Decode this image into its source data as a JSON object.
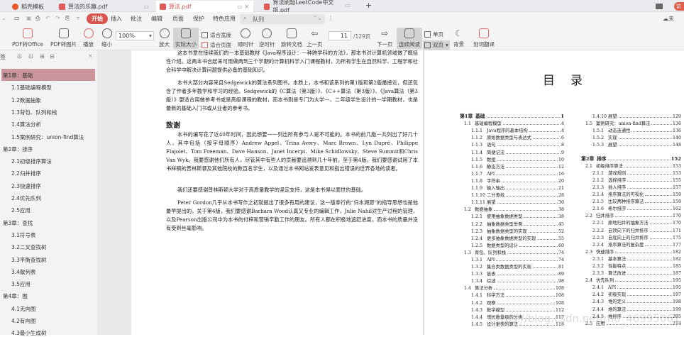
{
  "tabs": [
    {
      "label": "稻壳模板",
      "active": false
    },
    {
      "label": "算法的乐趣.pdf",
      "active": false
    },
    {
      "label": "算法.pdf",
      "active": true
    },
    {
      "label": "算法刷题LeetCode中文版.pdf",
      "active": false
    }
  ],
  "new_tab": "+",
  "account_button": "访",
  "menu": {
    "items": [
      "开始",
      "插入",
      "批注",
      "编辑",
      "页面",
      "保护",
      "特色应用"
    ],
    "search_value": "队列",
    "cloud": "未"
  },
  "toolbar": {
    "pdf_to_office": "PDF转Office",
    "pdf_to_image": "PDF转图片",
    "play": "播放",
    "zoom_out": "缩小",
    "zoom_value": "100%",
    "zoom_in": "放大",
    "actual_size": "实际大小",
    "fit_width": "适合宽度",
    "fit_page": "适合页面",
    "rotate_cw": "顺时针",
    "rotate_ccw": "逆时针",
    "rotate_doc": "旋转文档",
    "prev_page": "上一页",
    "page_current": "11",
    "page_total": "/129页",
    "next_page": "下一页",
    "continuous": "连续阅读",
    "single": "单页",
    "double": "双页",
    "background": "背景",
    "translate": "划词翻译"
  },
  "sidebar": {
    "title": "签",
    "close": "×",
    "items": [
      {
        "label": "第1章：基础",
        "level": 0
      },
      {
        "label": "1.1基础编程模型",
        "level": 1
      },
      {
        "label": "1.2数据抽象",
        "level": 1
      },
      {
        "label": "1.3背包、队列和栈",
        "level": 1
      },
      {
        "label": "1.4算法分析",
        "level": 1
      },
      {
        "label": "1.5案例研究：union-find算法",
        "level": 1
      },
      {
        "label": "第2章：排序",
        "level": 0
      },
      {
        "label": "2.1初级排序算法",
        "level": 1
      },
      {
        "label": "2.2归并排序",
        "level": 1
      },
      {
        "label": "2.3快速排序",
        "level": 1
      },
      {
        "label": "2.4优先队列",
        "level": 1
      },
      {
        "label": "2.5应用",
        "level": 1
      },
      {
        "label": "第3章：查找",
        "level": 0
      },
      {
        "label": "3.1符号表",
        "level": 1
      },
      {
        "label": "3.2二叉查找树",
        "level": 1
      },
      {
        "label": "3.3平衡查找树",
        "level": 1
      },
      {
        "label": "3.4散列表",
        "level": 1
      },
      {
        "label": "3.5应用",
        "level": 1
      },
      {
        "label": "第4章：图",
        "level": 0
      },
      {
        "label": "4.1无向图",
        "level": 1
      },
      {
        "label": "4.2有向图",
        "level": 1
      },
      {
        "label": "4.3最小生成树",
        "level": 1
      }
    ]
  },
  "left_page": {
    "para1": "这本书意在接续我们的一本基础教材《Java程序设计：一种跨学科的方法》，那本书对计算机领域做了概括性介绍。这两本书合起来可用做两到三个学期的计算机科学入门课程教材，为所有学生在自然科学、工程学和社会科学中解决计算问题提供必备的基础知识。",
    "para2": "本书大部分内容来自Sedgewick的算法系列图书。本质上，本书和该系列的第1版和第2版最接近，但还包含了作者多年教学和学习的经验。Sedgewick的《C算法（第3版）》、《C++算法（第3版）》、《Java算法（第3版）》更适合用做参考书或是高级课程的教材，而本书则是专门为大学一、二年级学生设计的一学期教材，也是最新的基础入门书或从业者的参考书。",
    "heading": "致谢",
    "para3": "本书的编写花了近40年时间，因此想要一一列出所有参与人是不可能的。本书的前几版一共列出了好几十人，其中包括（按字母顺序）Andrew Appel、Trina Avery、Marc Brown、Lyn Dupré、Philippe Flajolet、Tom Freeman、Dave Hanson、Janet Incerpi、Mike Schidlowsky、Steve Summit和Chris Van Wyk。我要感谢他们所有人，尽管其中有些人的贡献要追溯到几十年前。至于第4版，我们要感谢试用了本书样稿的普林斯顿及其他院校的数百名学生，以及通过本书网站发表意见和指出错误的世界各地的读者。",
    "para4": "我们还要感谢普林斯顿大学对于高质量教学的坚定支持，这是本书得以面世的基础。",
    "para5": "Peter Gordon几乎从本书写作之初就提出了很多有用的建议，这一版奉行的“归本溯源”的指导思想也是他最早提出的。关于第4版，我们要感谢Barbara Wood认真又专业的编辑工作，Julie Nahil对生产过程的管理，以及Pearson出版公司中为本书的付梓和营销辛勤工作的朋友。所有人都在积极地追赶进度，而本书的质量并没有受到丝毫影响。"
  },
  "right_page": {
    "title": "目录",
    "watermark": "https://blog.csdn.net/m0_46995061",
    "toc_left": [
      {
        "num": "第1章",
        "title": "基础",
        "page": "1",
        "level": 0
      },
      {
        "num": "1.1",
        "title": "基础编程模型",
        "page": "4",
        "level": 1
      },
      {
        "num": "1.1.1",
        "title": "Java程序的基本结构",
        "page": "4",
        "level": 2
      },
      {
        "num": "1.1.2",
        "title": "原始数据类型与表达式",
        "page": "6",
        "level": 2
      },
      {
        "num": "1.1.3",
        "title": "语句",
        "page": "8",
        "level": 2
      },
      {
        "num": "1.1.4",
        "title": "简便记法",
        "page": "9",
        "level": 2
      },
      {
        "num": "1.1.5",
        "title": "数组",
        "page": "10",
        "level": 2
      },
      {
        "num": "1.1.6",
        "title": "静态方法",
        "page": "12",
        "level": 2
      },
      {
        "num": "1.1.7",
        "title": "API",
        "page": "16",
        "level": 2
      },
      {
        "num": "1.1.8",
        "title": "字符串",
        "page": "20",
        "level": 2
      },
      {
        "num": "1.1.9",
        "title": "输入输出",
        "page": "21",
        "level": 2
      },
      {
        "num": "1.1.10",
        "title": "二分查找",
        "page": "28",
        "level": 2
      },
      {
        "num": "1.1.11",
        "title": "展望",
        "page": "30",
        "level": 2
      },
      {
        "num": "1.2",
        "title": "数据抽象",
        "page": "38",
        "level": 1
      },
      {
        "num": "1.2.1",
        "title": "使用抽象数据类型",
        "page": "38",
        "level": 2
      },
      {
        "num": "1.2.2",
        "title": "抽象数据类型举例",
        "page": "45",
        "level": 2
      },
      {
        "num": "1.2.3",
        "title": "抽象数据类型的实现",
        "page": "52",
        "level": 2
      },
      {
        "num": "1.2.4",
        "title": "更多抽象数据类型的实现",
        "page": "55",
        "level": 2
      },
      {
        "num": "1.2.5",
        "title": "数据类型的设计",
        "page": "60",
        "level": 2
      },
      {
        "num": "1.3",
        "title": "背包、队列和栈",
        "page": "74",
        "level": 1
      },
      {
        "num": "1.3.1",
        "title": "API",
        "page": "74",
        "level": 2
      },
      {
        "num": "1.3.2",
        "title": "集合类数据类型的实现",
        "page": "81",
        "level": 2
      },
      {
        "num": "1.3.3",
        "title": "链表",
        "page": "89",
        "level": 2
      },
      {
        "num": "1.3.4",
        "title": "综述",
        "page": "98",
        "level": 2
      },
      {
        "num": "1.4",
        "title": "算法分析",
        "page": "108",
        "level": 1
      },
      {
        "num": "1.4.1",
        "title": "科学方法",
        "page": "108",
        "level": 2
      },
      {
        "num": "1.4.2",
        "title": "观察",
        "page": "108",
        "level": 2
      },
      {
        "num": "1.4.3",
        "title": "数学模型",
        "page": "112",
        "level": 2
      },
      {
        "num": "1.4.4",
        "title": "增长数量级的分类",
        "page": "117",
        "level": 2
      },
      {
        "num": "1.4.5",
        "title": "设计更快的算法",
        "page": "118",
        "level": 2
      }
    ],
    "toc_right": [
      {
        "num": "1.4.10",
        "title": "展望",
        "page": "129",
        "level": 2
      },
      {
        "num": "1.5",
        "title": "案例研究：union-find算法",
        "page": "136",
        "level": 1
      },
      {
        "num": "1.5.1",
        "title": "动态连通性",
        "page": "136",
        "level": 2
      },
      {
        "num": "1.5.2",
        "title": "实现",
        "page": "140",
        "level": 2
      },
      {
        "num": "1.5.3",
        "title": "展望",
        "page": "148",
        "level": 2
      },
      {
        "num": "第2章",
        "title": "排序",
        "page": "152",
        "level": 0
      },
      {
        "num": "2.1",
        "title": "初级排序算法",
        "page": "153",
        "level": 1
      },
      {
        "num": "2.1.1",
        "title": "游戏规则",
        "page": "153",
        "level": 2
      },
      {
        "num": "2.1.2",
        "title": "选择排序",
        "page": "155",
        "level": 2
      },
      {
        "num": "2.1.3",
        "title": "插入排序",
        "page": "157",
        "level": 2
      },
      {
        "num": "2.1.4",
        "title": "排序算法的可视化",
        "page": "159",
        "level": 2
      },
      {
        "num": "2.1.5",
        "title": "比较两种排序算法",
        "page": "159",
        "level": 2
      },
      {
        "num": "2.1.6",
        "title": "希尔排序",
        "page": "162",
        "level": 2
      },
      {
        "num": "2.2",
        "title": "归并排序",
        "page": "170",
        "level": 1
      },
      {
        "num": "2.2.1",
        "title": "原地归并的抽象方法",
        "page": "170",
        "level": 2
      },
      {
        "num": "2.2.2",
        "title": "自顶向下的归并排序",
        "page": "171",
        "level": 2
      },
      {
        "num": "2.2.3",
        "title": "自底向上的归并排序",
        "page": "175",
        "level": 2
      },
      {
        "num": "2.2.4",
        "title": "排序算法的复杂度",
        "page": "177",
        "level": 2
      },
      {
        "num": "2.3",
        "title": "快速排序",
        "page": "182",
        "level": 1
      },
      {
        "num": "2.3.1",
        "title": "基本算法",
        "page": "182",
        "level": 2
      },
      {
        "num": "2.3.2",
        "title": "性能特点",
        "page": "185",
        "level": 2
      },
      {
        "num": "2.3.3",
        "title": "算法改进",
        "page": "187",
        "level": 2
      },
      {
        "num": "2.4",
        "title": "优先队列",
        "page": "195",
        "level": 1
      },
      {
        "num": "2.4.1",
        "title": "API",
        "page": "195",
        "level": 2
      },
      {
        "num": "2.4.2",
        "title": "初级实现",
        "page": "197",
        "level": 2
      },
      {
        "num": "2.4.3",
        "title": "堆的定义",
        "page": "198",
        "level": 2
      },
      {
        "num": "2.4.4",
        "title": "堆的算法",
        "page": "199",
        "level": 2
      },
      {
        "num": "2.4.5",
        "title": "堆排序",
        "page": "205",
        "level": 2
      },
      {
        "num": "2.5",
        "title": "应用",
        "page": "214",
        "level": 1
      }
    ]
  }
}
